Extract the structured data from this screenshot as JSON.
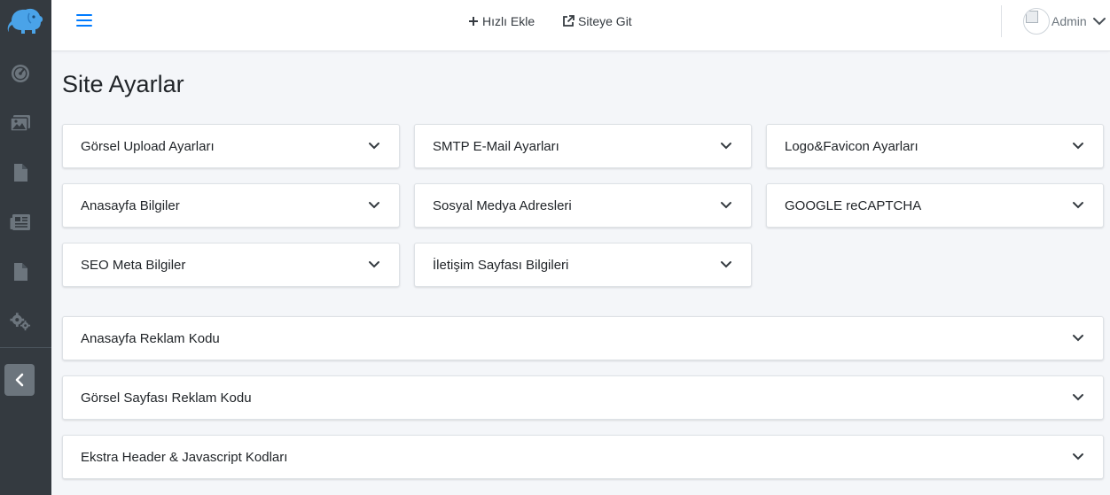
{
  "nav": {
    "quick_add": "Hızlı Ekle",
    "goto_site": "Siteye Git",
    "user": "Admin"
  },
  "page": {
    "title": "Site Ayarlar"
  },
  "panels": {
    "grid": [
      "Görsel Upload Ayarları",
      "SMTP E-Mail Ayarları",
      "Logo&Favicon Ayarları",
      "Anasayfa Bilgiler",
      "Sosyal Medya Adresleri",
      "GOOGLE reCAPTCHA",
      "SEO Meta Bilgiler",
      "İletişim Sayfası Bilgileri"
    ],
    "wide": [
      "Anasayfa Reklam Kodu",
      "Görsel Sayfası Reklam Kodu",
      "Ekstra Header & Javascript Kodları"
    ]
  },
  "colors": {
    "sidebar": "#343a40",
    "accent": "#007bff",
    "brand": "#4aa3e8"
  },
  "icons": {
    "sidebar": [
      "dashboard-icon",
      "images-icon",
      "file-icon",
      "newspaper-icon",
      "file-icon",
      "cogs-icon",
      "chevron-left-icon"
    ]
  }
}
